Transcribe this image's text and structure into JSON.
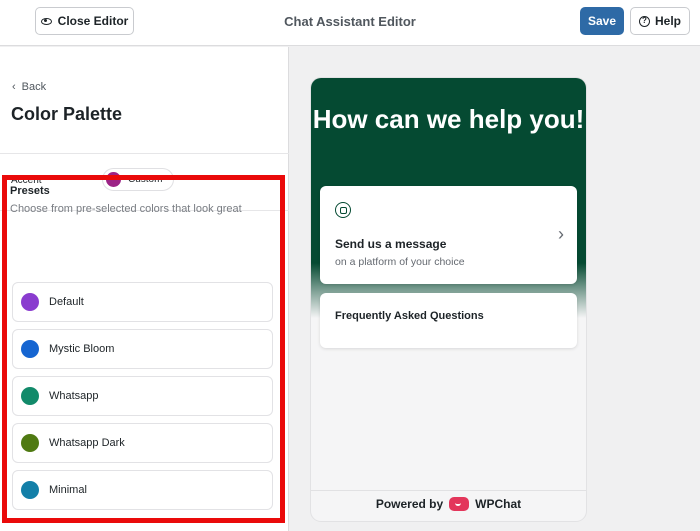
{
  "header": {
    "close_label": "Close Editor",
    "title": "Chat Assistant Editor",
    "save_label": "Save",
    "help_label": "Help"
  },
  "sidebar": {
    "back_label": "Back",
    "title": "Color Palette",
    "accent": {
      "label": "Accent",
      "value": "Custom",
      "color": "#9c2386"
    },
    "presets": {
      "title": "Presets",
      "description": "Choose from pre-selected colors that look great",
      "items": [
        {
          "label": "Default",
          "color": "#8a3ccf"
        },
        {
          "label": "Mystic Bloom",
          "color": "#1565d1"
        },
        {
          "label": "Whatsapp",
          "color": "#128a6a"
        },
        {
          "label": "Whatsapp Dark",
          "color": "#4f7a12"
        },
        {
          "label": "Minimal",
          "color": "#137fa8"
        }
      ]
    }
  },
  "preview": {
    "heading": "How can we help you!",
    "card1": {
      "title": "Send us a message",
      "subtitle": "on a platform of your choice"
    },
    "card2": {
      "title": "Frequently Asked Questions"
    },
    "footer": {
      "powered_by": "Powered by",
      "brand": "WPChat"
    },
    "theme_color": "#054a32"
  }
}
